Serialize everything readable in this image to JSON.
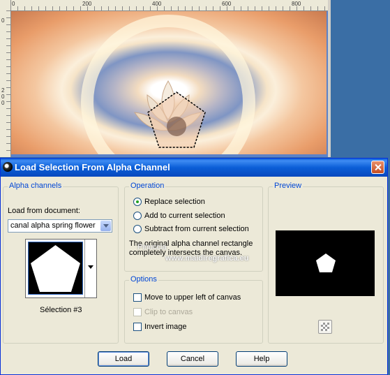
{
  "background_window": {
    "ruler_ticks_top": [
      "0",
      "200",
      "400",
      "600",
      "800"
    ],
    "ruler_ticks_left": [
      "0",
      "2",
      "0",
      "0"
    ]
  },
  "dialog": {
    "title": "Load Selection From Alpha Channel",
    "alpha_channels": {
      "group_label": "Alpha channels",
      "load_from_label": "Load from document:",
      "document_value": "canal alpha spring flower",
      "selection_name": "Sélection #3"
    },
    "operation": {
      "group_label": "Operation",
      "options": [
        {
          "label": "Replace selection",
          "selected": true
        },
        {
          "label": "Add to current selection",
          "selected": false
        },
        {
          "label": "Subtract from current selection",
          "selected": false
        }
      ],
      "info_line1": "The original alpha channel rectangle",
      "info_line2": "completely intersects the canvas."
    },
    "options": {
      "group_label": "Options",
      "move_upper_left": "Move to upper left of canvas",
      "clip_to_canvas": "Clip to canvas",
      "invert_image": "Invert image"
    },
    "preview": {
      "group_label": "Preview"
    },
    "buttons": {
      "load": "Load",
      "cancel": "Cancel",
      "help": "Help"
    },
    "watermark": {
      "line1": "Pinuccia",
      "line2": "www.maidiregrafica.eu"
    }
  }
}
